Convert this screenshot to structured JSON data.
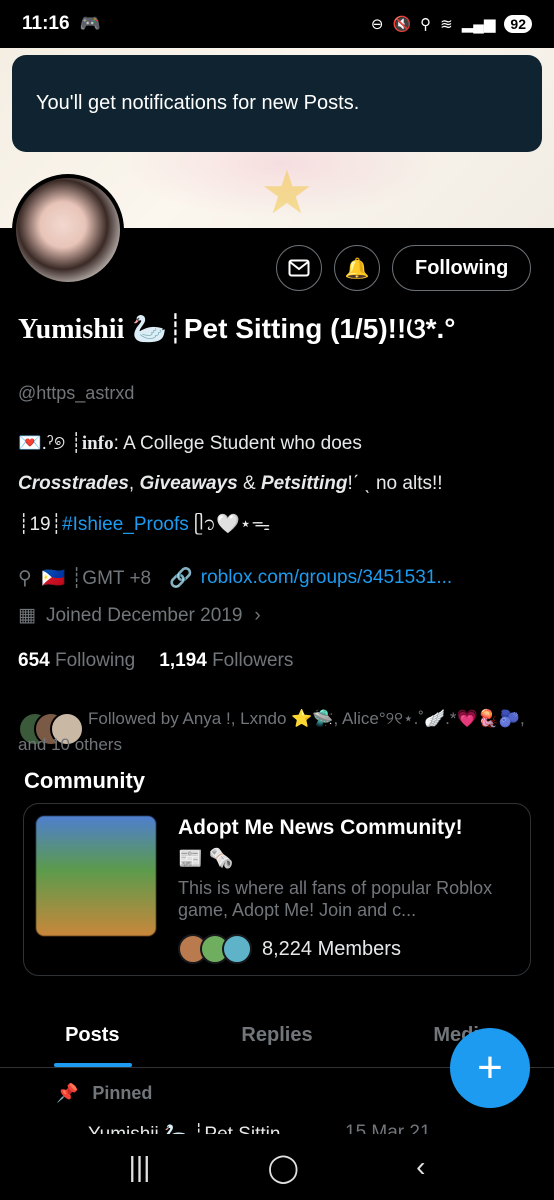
{
  "status": {
    "time": "11:16",
    "battery": "92"
  },
  "toast": {
    "text": "You'll get notifications for new Posts."
  },
  "profile": {
    "name_prefix": "Yumishii",
    "name_emoji": "🦢",
    "name_suffix": "┊Pet Sitting (1/5)!!ଓ*.°",
    "handle": "@https_astrxd",
    "bio_line1_prefix": "💌.ˀ୭ ┊",
    "bio_line1_info": "info",
    "bio_line1_rest": ": A College Student who does",
    "bio_line2_a": "Crosstrades",
    "bio_line2_sep1": ", ",
    "bio_line2_b": "Giveaways",
    "bio_line2_sep2": " & ",
    "bio_line2_c": "Petsitting",
    "bio_line2_rest": "!ˊ ˎ no alts!!",
    "bio_line3_prefix": "┊19┊",
    "bio_line3_hashtag": "#Ishiee_Proofs",
    "bio_line3_suffix": " ᥫ᭡🤍⋆ᯓ",
    "location": "🇵🇭 ┊GMT +8",
    "website": "roblox.com/groups/3451531...",
    "joined": "Joined December 2019",
    "following_count": "654",
    "following_label": "Following",
    "followers_count": "1,194",
    "followers_label": "Followers",
    "followed_by": "Followed by Anya !, Lxndo ⭐🛸, Alice°୨୧⋆.˚🪽.*💗🪼🫐, and 10 others"
  },
  "buttons": {
    "following": "Following"
  },
  "community": {
    "section_title": "Community",
    "name": "Adopt Me News Community!",
    "emoji": "📰 🗞️",
    "description": "This is where all fans of popular Roblox game, Adopt Me! Join and c...",
    "members": "8,224 Members"
  },
  "tabs": [
    {
      "label": "Posts",
      "active": true
    },
    {
      "label": "Replies",
      "active": false
    },
    {
      "label": "Media",
      "active": false
    }
  ],
  "pinned": {
    "label": "Pinned",
    "peek_name": "Yumishii 🦢 ┊Pet Sittin",
    "peek_date": "15 Mar 21"
  },
  "colors": {
    "accent": "#1d9bf0",
    "background": "#000000",
    "toast_bg": "#0f2430"
  }
}
